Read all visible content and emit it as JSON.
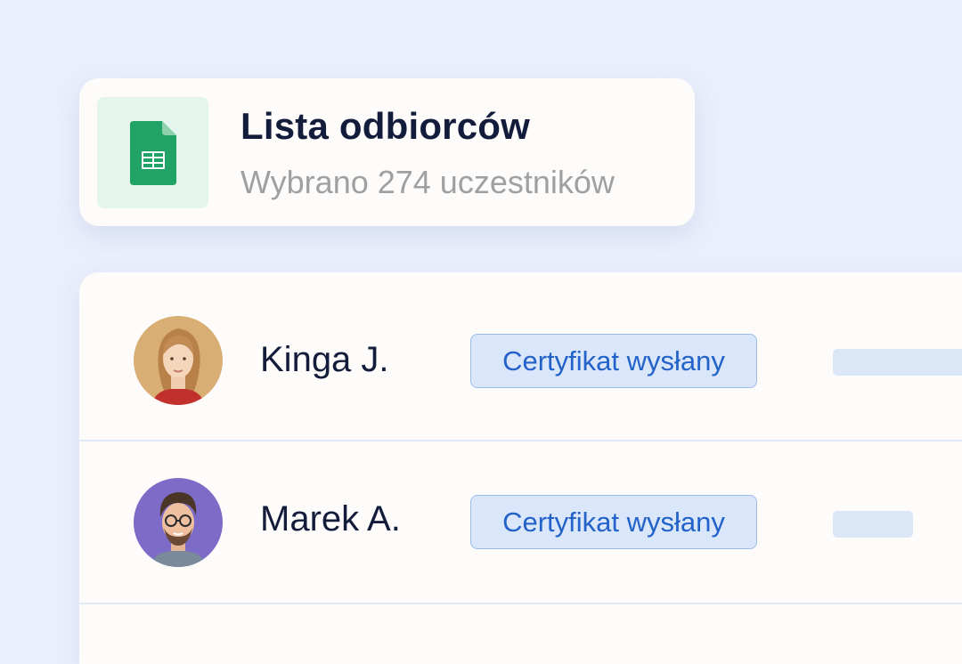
{
  "recipients_card": {
    "icon": "google-sheets-icon",
    "title": "Lista odbiorców",
    "subtitle": "Wybrano 274 uczestników"
  },
  "recipients": [
    {
      "name": "Kinga J.",
      "avatar_icon": "woman-avatar",
      "status": "Certyfikat wysłany"
    },
    {
      "name": "Marek A.",
      "avatar_icon": "man-avatar",
      "status": "Certyfikat wysłany"
    }
  ],
  "colors": {
    "background": "#e9effc",
    "card": "#fdfcfb",
    "title": "#141c3c",
    "subtitle": "#a0a0a0",
    "badge_bg": "#dae6fa",
    "badge_border": "#9dbbe9",
    "badge_text": "#2262c9",
    "sheets_green": "#21a366"
  }
}
